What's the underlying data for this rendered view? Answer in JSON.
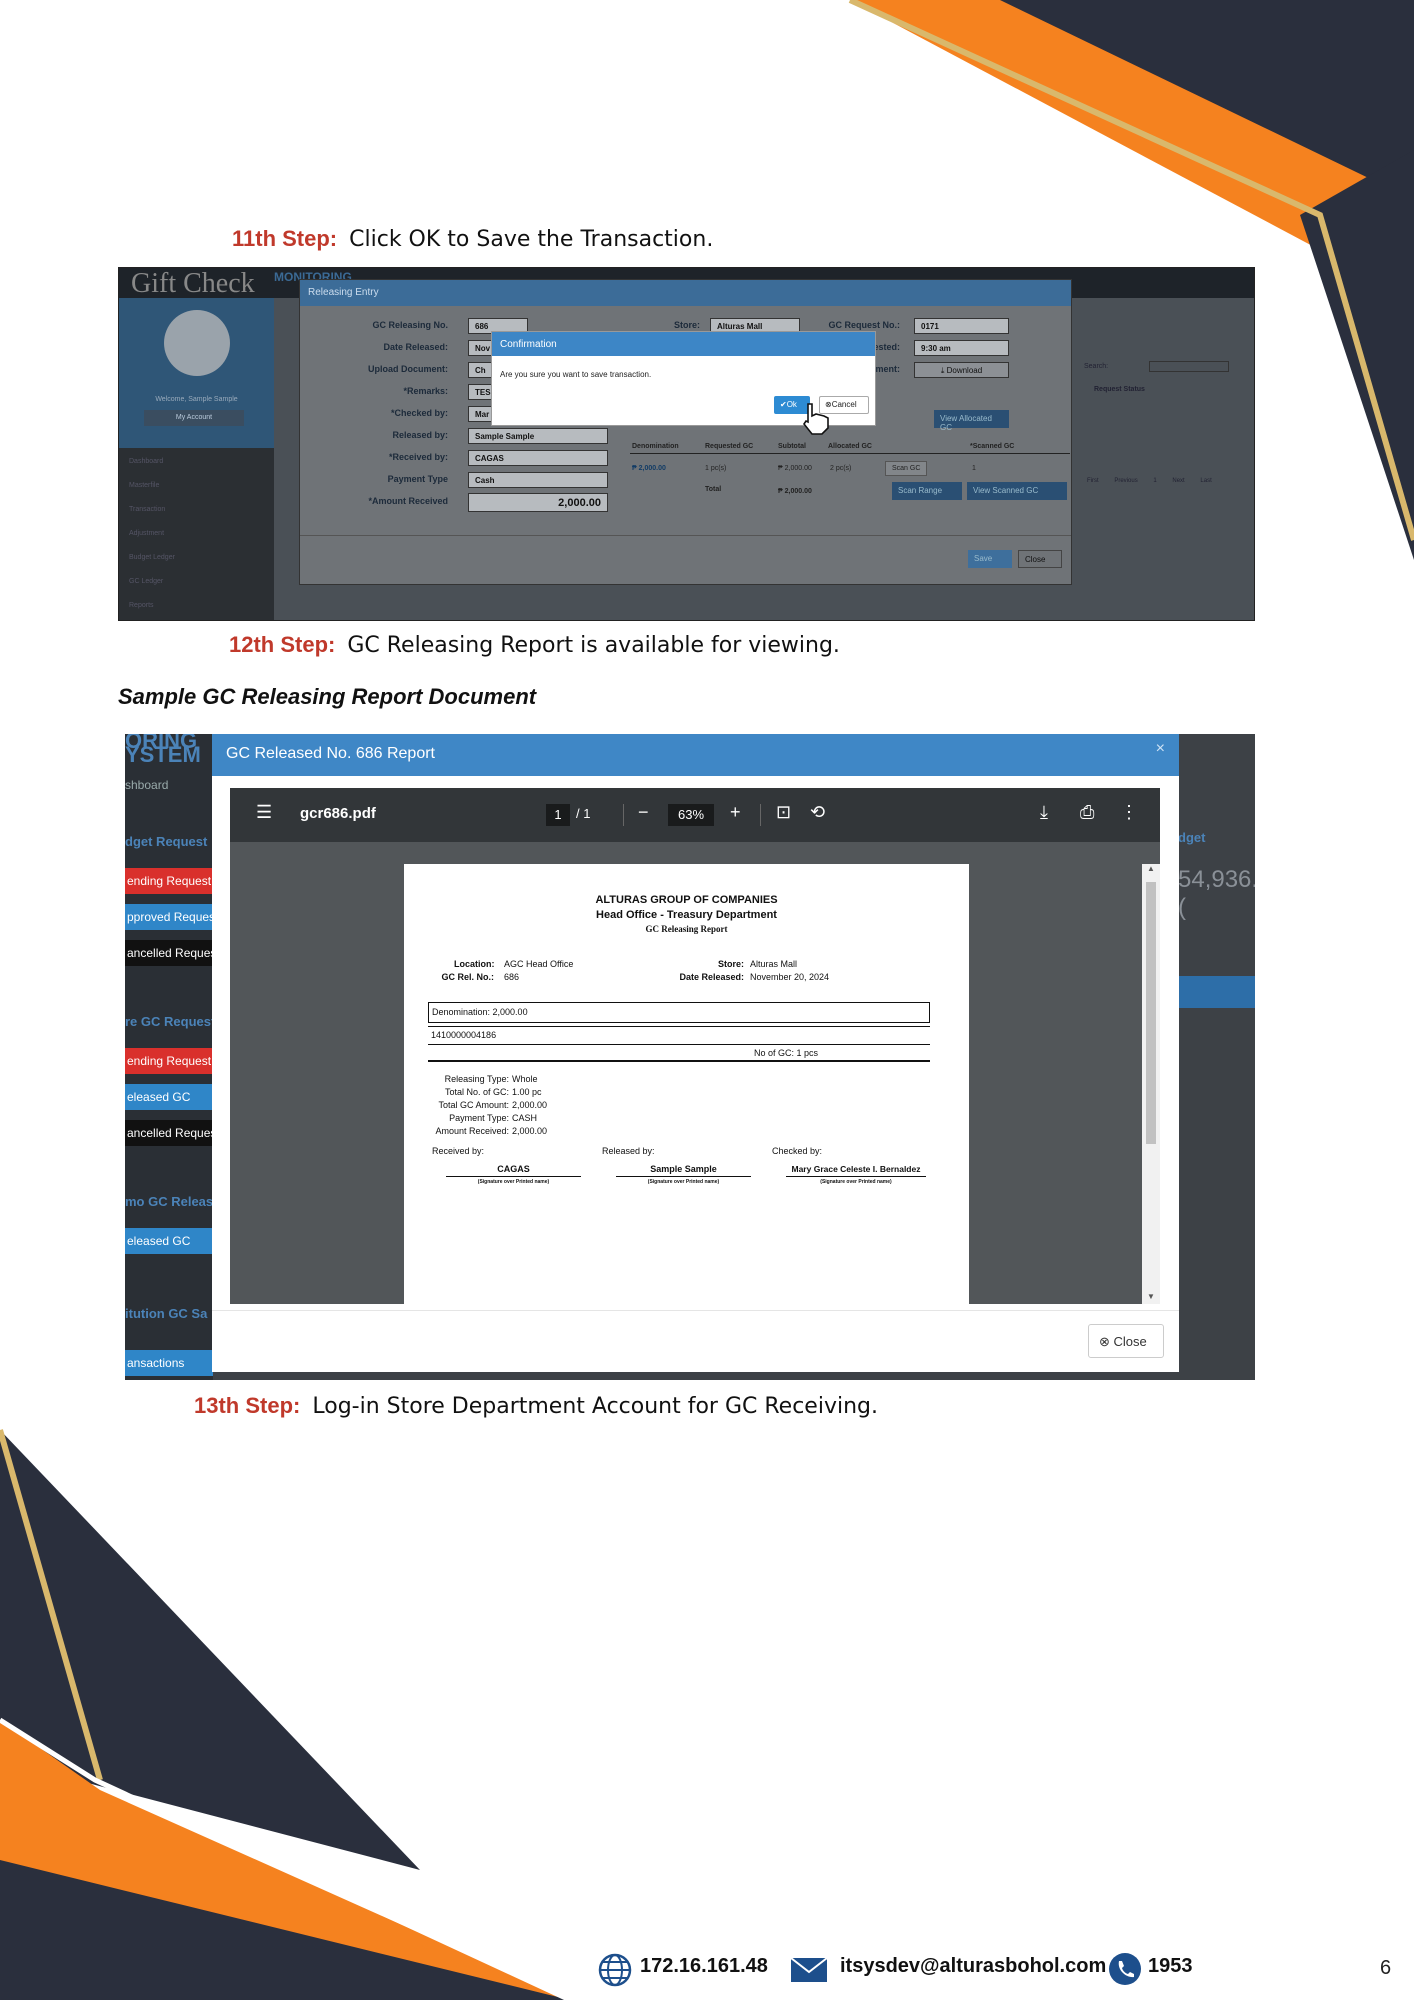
{
  "steps": {
    "s11_label": "11th Step:",
    "s11_text": "Click OK to Save the Transaction.",
    "s12_label": "12th Step:",
    "s12_text": "GC Releasing Report is available for viewing.",
    "s13_label": "13th Step:",
    "s13_text": "Log-in Store Department Account for GC Receiving."
  },
  "subheading": "Sample GC Releasing Report Document",
  "shot1": {
    "logo": "Gift Check",
    "logo_sub": "MONITORING",
    "welcome": "Welcome, Sample Sample",
    "my_account": "My Account",
    "nav": [
      "Dashboard",
      "Masterfile",
      "Transaction",
      "Adjustment",
      "Budget Ledger",
      "GC Ledger",
      "Reports"
    ],
    "modal_title": "Releasing Entry",
    "fields": {
      "gc_releasing_no_label": "GC Releasing No.",
      "gc_releasing_no": "686",
      "date_released_label": "Date Released:",
      "date_released": "Nov",
      "upload_document_label": "Upload Document:",
      "upload_document": "Ch",
      "remarks_label": "*Remarks:",
      "remarks": "TES",
      "checked_by_label": "*Checked by:",
      "checked_by": "Mar",
      "released_by_label": "Released by:",
      "released_by": "Sample Sample",
      "received_by_label": "*Received by:",
      "received_by": "CAGAS",
      "payment_type_label": "Payment Type",
      "payment_type": "Cash",
      "amount_received_label": "*Amount Received",
      "amount_received": "2,000.00",
      "store_label": "Store:",
      "store": "Alturas Mall",
      "gc_request_no_label": "GC Request No.:",
      "gc_request_no": "0171",
      "time_requested_label": "Time Requested:",
      "time_requested": "9:30 am",
      "document_label": "Document:",
      "download": "Download"
    },
    "view_allocated": "View Allocated GC",
    "table_headers": [
      "Denomination",
      "Requested GC",
      "Subtotal",
      "Allocated GC",
      "*Scanned GC"
    ],
    "row": {
      "denomination": "₱ 2,000.00",
      "requested": "1 pc(s)",
      "subtotal": "₱ 2,000.00",
      "allocated": "2 pc(s)",
      "scan_gc": "Scan GC",
      "scanned": "1"
    },
    "total_label": "Total",
    "total_value": "₱ 2,000.00",
    "scan_range": "Scan Range",
    "view_scanned": "View Scanned GC",
    "save": "Save",
    "close": "Close",
    "search_label": "Search:",
    "request_status": "Request Status",
    "pager": [
      "First",
      "Previous",
      "1",
      "Next",
      "Last"
    ],
    "confirm_title": "Confirmation",
    "confirm_text": "Are you sure you want to save transaction.",
    "ok": "Ok",
    "cancel": "Cancel"
  },
  "shot2": {
    "left_labels": [
      "ORING",
      "YSTEM",
      "shboard",
      "dget Request",
      "ending Request",
      "pproved Reques",
      "ancelled Reques",
      "re GC Request",
      "ending Request",
      "eleased GC",
      "ancelled Reques",
      "mo GC Releas",
      "eleased GC",
      "itution GC Sa",
      "ansactions"
    ],
    "right_labels": [
      "dget",
      "54,936.("
    ],
    "modal_title": "GC Released No. 686 Report",
    "file_name": "gcr686.pdf",
    "page_current": "1",
    "page_total": "/ 1",
    "zoom": "63%",
    "report": {
      "company": "ALTURAS GROUP OF COMPANIES",
      "department": "Head Office - Treasury Department",
      "title": "GC Releasing Report",
      "location_label": "Location:",
      "location": "AGC Head Office",
      "rel_no_label": "GC Rel. No.:",
      "rel_no": "686",
      "store_label": "Store:",
      "store": "Alturas Mall",
      "date_label": "Date Released:",
      "date": "November 20, 2024",
      "denomination": "Denomination: 2,000.00",
      "barcode": "1410000004186",
      "no_of_gc": "No of GC:  1 pcs",
      "releasing_type_label": "Releasing Type:",
      "releasing_type": "Whole",
      "total_no_label": "Total No. of GC:",
      "total_no": "1.00 pc",
      "total_amount_label": "Total GC Amount:",
      "total_amount": "2,000.00",
      "payment_type_label": "Payment Type:",
      "payment_type": "CASH",
      "amount_received_label": "Amount Received:",
      "amount_received": "2,000.00",
      "received_by_label": "Received by:",
      "received_by": "CAGAS",
      "released_by_label": "Released by:",
      "released_by": "Sample Sample",
      "checked_by_label": "Checked by:",
      "checked_by": "Mary Grace Celeste I. Bernaldez",
      "signature_caption": "(Signature over Printed name)"
    },
    "close": "Close"
  },
  "footer": {
    "ip": "172.16.161.48",
    "email": "itsysdev@alturasbohol.com",
    "phone": "1953",
    "page_number": "6"
  },
  "colors": {
    "orange": "#f5821f",
    "navy": "#2a2f3d",
    "gold": "#d9b86c",
    "step_red": "#c0392b"
  }
}
